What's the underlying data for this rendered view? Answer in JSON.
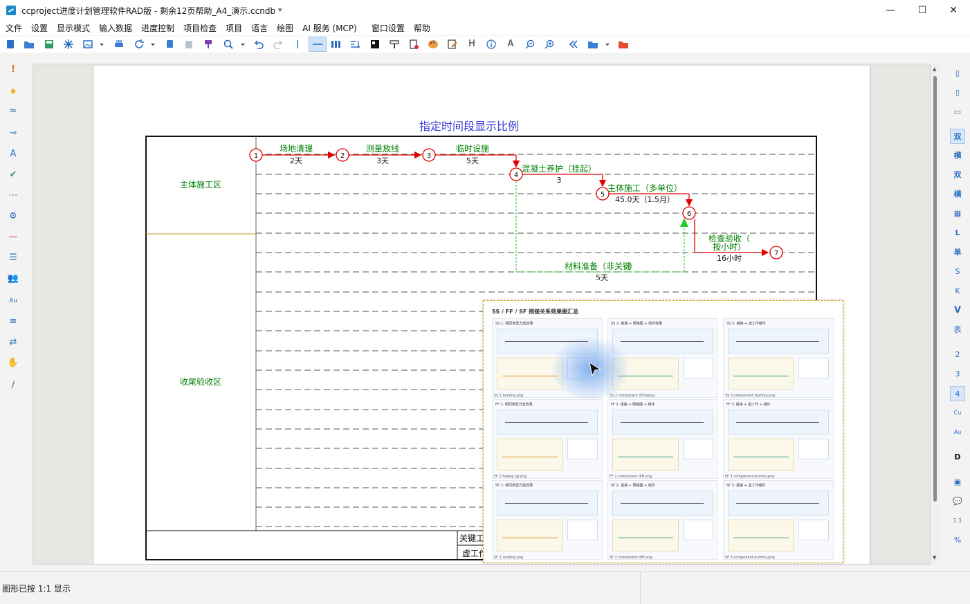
{
  "window": {
    "title": "ccproject进度计划管理软件RAD版 - 剩余12页帮助_A4_演示.ccndb *",
    "minimize": "—",
    "maximize": "☐",
    "close": "✕"
  },
  "menu": [
    "文件",
    "设置",
    "显示模式",
    "输入数据",
    "进度控制",
    "项目检查",
    "项目",
    "语言",
    "绘图",
    "AI 服务 (MCP)",
    "窗口设置",
    "帮助"
  ],
  "toolbar": {
    "icons": [
      "new-icon",
      "open-icon",
      "save-icon",
      "star-icon",
      "image-icon",
      "dropdown-icon",
      "print-icon",
      "refresh-icon",
      "dropdown-icon",
      "copy-icon",
      "paste-icon",
      "brush-icon",
      "zoom-icon",
      "dropdown-icon",
      "undo-icon",
      "redo-icon",
      "separator-icon",
      "line-icon",
      "bars-icon",
      "sort-icon",
      "grid-icon",
      "format-icon",
      "stamp-icon",
      "palette-icon",
      "edit-icon",
      "header-icon",
      "info-icon",
      "text-icon",
      "zoom-out-icon",
      "zoom-in-icon",
      "back-icon",
      "folder-icon",
      "dropdown-icon",
      "red-folder-icon"
    ],
    "header_glyph": "H",
    "text_glyph": "A"
  },
  "right_bar": [
    "双",
    "横",
    "双",
    "横",
    "L",
    "单",
    "S",
    "K",
    "V",
    "表",
    "2",
    "3",
    "4",
    "Cu",
    "Au",
    "D",
    "1:1",
    "%"
  ],
  "diagram": {
    "title": "指定时间段显示比例",
    "zones": [
      "主体施工区",
      "收尾验收区"
    ],
    "nodes": [
      "1",
      "2",
      "3",
      "4",
      "5",
      "6",
      "7"
    ],
    "activities": [
      {
        "name": "场地清理",
        "duration": "2天"
      },
      {
        "name": "测量放线",
        "duration": "3天"
      },
      {
        "name": "临时设施",
        "duration": "5天"
      },
      {
        "name": "混凝土养护（挂起）",
        "duration": "3"
      },
      {
        "name": "主体施工（多单位）",
        "duration": "45.0天（1.5月）"
      },
      {
        "name": "检查验收（",
        "name2": "按小时）",
        "duration": "16小时"
      },
      {
        "name": "材料准备（非关键",
        "name_end": "）",
        "duration": "5天"
      }
    ],
    "legend": [
      "关键工",
      "虚工作"
    ]
  },
  "popup": {
    "title": "SS / FF / SF 搭接关系效果图汇总",
    "captions": [
      "SS 1 landing.png",
      "SS 2 component dhitepng",
      "SS 3 component dummy.png",
      "FF 1 foreng.ng.png",
      "FF 2 component diff.png",
      "FF 3 component dummy.png",
      "SF 1 landing.png",
      "SF 2 component diff.png",
      "SF 3 component dummy.png"
    ],
    "heads": [
      "SS 1: 相同类型方案效果",
      "SS 2: 搭接 + 网络图 + 组件效果",
      "SS 3: 搭接 + 虚工作组件",
      "FF 1: 相同类型方案效果",
      "FF 2: 搭接 + 网络图 + 组件",
      "FF 3: 搭接 + 虚工作 + 组件",
      "SF 1: 相同类型方案效果",
      "SF 2: 搭接 + 网络图 + 组件",
      "SF 3: 搭接 + 虚工作组件"
    ]
  },
  "status": {
    "text": "图形已按 1:1 显示"
  },
  "colors": {
    "activity": "#e00000",
    "label": "#008000",
    "title": "#3a3ad8",
    "dummy": "#22bb22"
  }
}
